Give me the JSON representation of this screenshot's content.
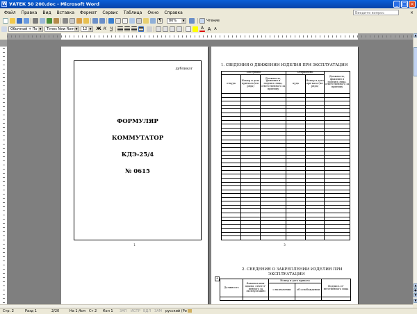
{
  "window": {
    "title": "УАТЕК 50 200.doc - Microsoft Word"
  },
  "menu": {
    "items": [
      "Файл",
      "Правка",
      "Вид",
      "Вставка",
      "Формат",
      "Сервис",
      "Таблица",
      "Окно",
      "Справка"
    ],
    "question_placeholder": "Введите вопрос"
  },
  "toolbar": {
    "zoom": "80%",
    "read_label": "Чтение",
    "style": "Обычный + По",
    "font": "Times New Roman",
    "size": "12"
  },
  "page1": {
    "duplicate": "дубликат",
    "line1": "ФОРМУЛЯР",
    "line2": "КОММУТАТОР",
    "line3": "КДЭ-25/4",
    "line4": "№ 0615",
    "page_number": "1"
  },
  "page2": {
    "section_title": "1. СВЕДЕНИЯ О ДВИЖЕНИИ ИЗДЕЛИЯ ПРИ ЭКСПЛУАТАЦИИ",
    "group_received": "Поступило",
    "group_sent": "Отправлено",
    "col_from": "откуда",
    "col_doc_no": "Номер и дата при-каза (на-ряда)",
    "col_official": "Должность, фамилия и подпись лица, ответственного за приемку",
    "col_to": "куда",
    "col_doc_no2": "Номер и дата при-каза (на-ряда)",
    "col_official2": "Должность, фамилия и подпись лица, ответственного за приемку",
    "page_number": "3"
  },
  "page4": {
    "section_title_l1": "2. СВЕДЕНИЯ О ЗАКРЕПЛЕНИИ ИЗДЕЛИЯ ПРИ",
    "section_title_l2": "ЭКСПЛУАТАЦИИ",
    "col_position": "Должность",
    "col_name": "Фамилия ини-циалы, ответст-венного за эксплуатацию",
    "group_order": "Номер и дата приказа",
    "col_assign": "о назначении",
    "col_release": "об освобождении",
    "col_signature": "Подпись от-ветственного лица"
  },
  "status": {
    "page": "Стр. 2",
    "section": "Разд 1",
    "pages": "2/20",
    "at": "На 1,4см",
    "line": "Ст 2",
    "col": "Кол 1",
    "rec": "ЗАП",
    "trk": "ИСПР",
    "ext": "ВДЛ",
    "ovr": "ЗАМ",
    "language": "русский (Ро"
  },
  "colors": {
    "titlebar": "#0a5fd8",
    "chrome": "#ece9d8",
    "workspace": "#7f7f7f"
  }
}
